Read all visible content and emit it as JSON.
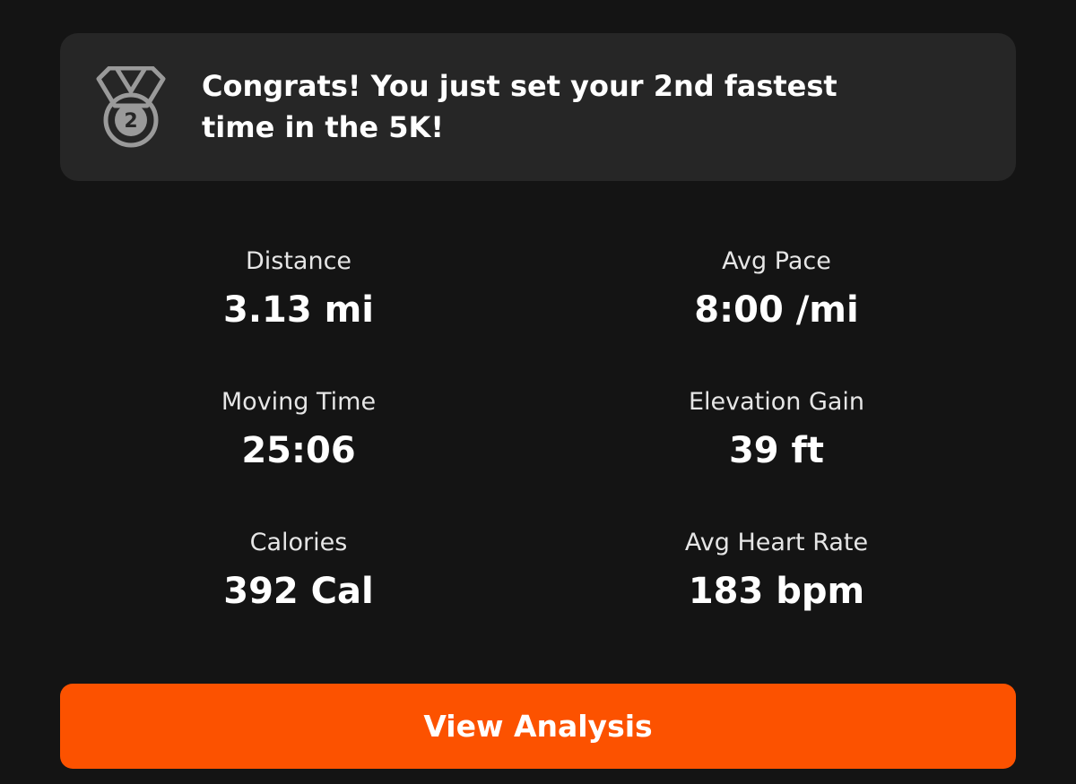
{
  "banner": {
    "icon": "second-place-medal-icon",
    "message": "Congrats! You just set your 2nd fastest time in the 5K!",
    "medal_rank": "2"
  },
  "stats": [
    {
      "label": "Distance",
      "value": "3.13 mi"
    },
    {
      "label": "Avg Pace",
      "value": "8:00 /mi"
    },
    {
      "label": "Moving Time",
      "value": "25:06"
    },
    {
      "label": "Elevation Gain",
      "value": "39 ft"
    },
    {
      "label": "Calories",
      "value": "392 Cal"
    },
    {
      "label": "Avg Heart Rate",
      "value": "183 bpm"
    }
  ],
  "actions": {
    "view_analysis_label": "View Analysis"
  },
  "colors": {
    "background": "#141414",
    "banner_background": "#262626",
    "accent": "#fc5200",
    "medal": "#9a9a9a"
  }
}
